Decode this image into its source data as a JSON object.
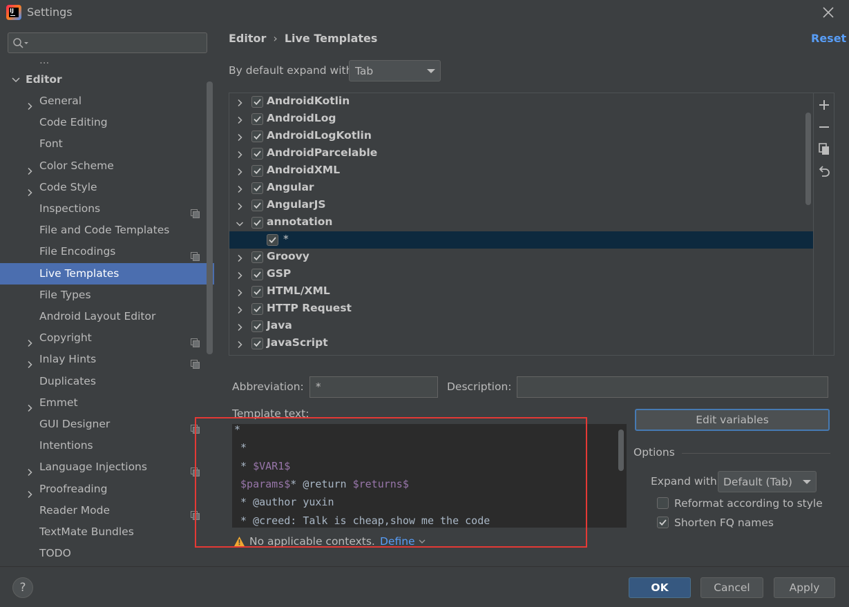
{
  "window": {
    "title": "Settings"
  },
  "search": {
    "placeholder": ""
  },
  "sidebar": {
    "partial_top": "...",
    "editor_label": "Editor",
    "items": [
      {
        "label": "General",
        "expandable": true,
        "project": false
      },
      {
        "label": "Code Editing",
        "expandable": false,
        "project": false
      },
      {
        "label": "Font",
        "expandable": false,
        "project": false
      },
      {
        "label": "Color Scheme",
        "expandable": true,
        "project": false
      },
      {
        "label": "Code Style",
        "expandable": true,
        "project": false
      },
      {
        "label": "Inspections",
        "expandable": false,
        "project": true
      },
      {
        "label": "File and Code Templates",
        "expandable": false,
        "project": false
      },
      {
        "label": "File Encodings",
        "expandable": false,
        "project": true
      },
      {
        "label": "Live Templates",
        "expandable": false,
        "project": false,
        "selected": true
      },
      {
        "label": "File Types",
        "expandable": false,
        "project": false
      },
      {
        "label": "Android Layout Editor",
        "expandable": false,
        "project": false
      },
      {
        "label": "Copyright",
        "expandable": true,
        "project": true
      },
      {
        "label": "Inlay Hints",
        "expandable": true,
        "project": true
      },
      {
        "label": "Duplicates",
        "expandable": false,
        "project": false
      },
      {
        "label": "Emmet",
        "expandable": true,
        "project": false
      },
      {
        "label": "GUI Designer",
        "expandable": false,
        "project": true
      },
      {
        "label": "Intentions",
        "expandable": false,
        "project": false
      },
      {
        "label": "Language Injections",
        "expandable": true,
        "project": true
      },
      {
        "label": "Proofreading",
        "expandable": true,
        "project": false
      },
      {
        "label": "Reader Mode",
        "expandable": false,
        "project": true
      },
      {
        "label": "TextMate Bundles",
        "expandable": false,
        "project": false
      },
      {
        "label": "TODO",
        "expandable": false,
        "project": false
      }
    ]
  },
  "header": {
    "breadcrumb": [
      "Editor",
      "Live Templates"
    ],
    "breadcrumb_sep": "›",
    "reset": "Reset"
  },
  "expand_default": {
    "label": "By default expand with",
    "value": "Tab"
  },
  "templates": [
    {
      "label": "AndroidKotlin",
      "expanded": false,
      "checked": true
    },
    {
      "label": "AndroidLog",
      "expanded": false,
      "checked": true
    },
    {
      "label": "AndroidLogKotlin",
      "expanded": false,
      "checked": true
    },
    {
      "label": "AndroidParcelable",
      "expanded": false,
      "checked": true
    },
    {
      "label": "AndroidXML",
      "expanded": false,
      "checked": true
    },
    {
      "label": "Angular",
      "expanded": false,
      "checked": true
    },
    {
      "label": "AngularJS",
      "expanded": false,
      "checked": true
    },
    {
      "label": "annotation",
      "expanded": true,
      "checked": true
    },
    {
      "label": "*",
      "child": true,
      "checked": true,
      "selected": true
    },
    {
      "label": "Groovy",
      "expanded": false,
      "checked": true
    },
    {
      "label": "GSP",
      "expanded": false,
      "checked": true
    },
    {
      "label": "HTML/XML",
      "expanded": false,
      "checked": true
    },
    {
      "label": "HTTP Request",
      "expanded": false,
      "checked": true
    },
    {
      "label": "Java",
      "expanded": false,
      "checked": true
    },
    {
      "label": "JavaScript",
      "expanded": false,
      "checked": true
    }
  ],
  "fields": {
    "abbreviation_label": "Abbreviation:",
    "abbreviation_value": "*",
    "description_label": "Description:",
    "description_value": "",
    "template_text_label": "Template text:"
  },
  "template_text": [
    [
      {
        "t": "*"
      }
    ],
    [
      {
        "t": " *"
      }
    ],
    [
      {
        "t": " * "
      },
      {
        "t": "$VAR1$",
        "var": true
      }
    ],
    [
      {
        "t": " "
      },
      {
        "t": "$params$",
        "var": true
      },
      {
        "t": "* @return "
      },
      {
        "t": "$returns$",
        "var": true
      }
    ],
    [
      {
        "t": " * @author yuxin"
      }
    ],
    [
      {
        "t": " * @creed: Talk is cheap,show me the code"
      }
    ]
  ],
  "contexts": {
    "warning": "No applicable contexts.",
    "define": "Define"
  },
  "options": {
    "edit_variables": "Edit variables",
    "title": "Options",
    "expand_with_label": "Expand with",
    "expand_with_value": "Default (Tab)",
    "reformat_label": "Reformat according to style",
    "reformat_checked": false,
    "shorten_label": "Shorten FQ names",
    "shorten_checked": true
  },
  "buttons": {
    "help": "?",
    "ok": "OK",
    "cancel": "Cancel",
    "apply": "Apply"
  },
  "colors": {
    "accent": "#4b6eaf",
    "link": "#589df6",
    "highlight_box": "#e53935",
    "template_var": "#9876aa"
  }
}
